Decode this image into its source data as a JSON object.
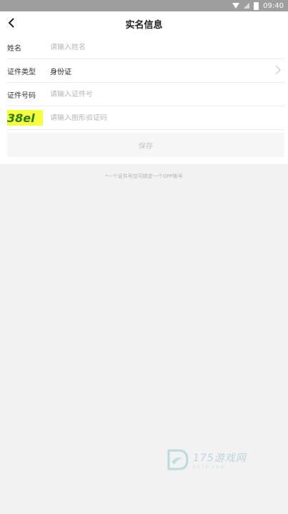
{
  "status_bar": {
    "time": "09:40"
  },
  "header": {
    "title": "实名信息"
  },
  "form": {
    "name": {
      "label": "姓名",
      "placeholder": "请输入姓名"
    },
    "id_type": {
      "label": "证件类型",
      "value": "身份证"
    },
    "id_number": {
      "label": "证件号码",
      "placeholder": "请输入证件号"
    },
    "captcha": {
      "code": "38el",
      "placeholder": "请输入图形验证码"
    }
  },
  "save_label": "保存",
  "tip": "*一个证件号仅可绑定一个OPP账号",
  "watermark": {
    "text": "175游戏网",
    "sub": "0175.com"
  },
  "colors": {
    "captcha_bg": "#f6ff3c",
    "status_bar": "#9e9e9e"
  }
}
